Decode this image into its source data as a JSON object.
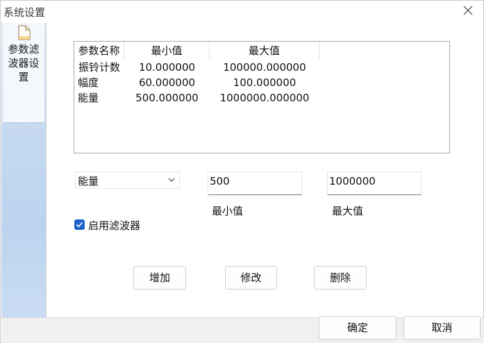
{
  "window": {
    "title": "系统设置",
    "close_icon": "close-icon"
  },
  "sidebar": {
    "items": [
      {
        "label": "参数滤波器设置",
        "icon": "document-icon"
      }
    ]
  },
  "table": {
    "columns": [
      "参数名称",
      "最小值",
      "最大值"
    ],
    "rows": [
      [
        "振铃计数",
        "10.000000",
        "100000.000000"
      ],
      [
        "幅度",
        "60.000000",
        "100.000000"
      ],
      [
        "能量",
        "500.000000",
        "1000000.000000"
      ]
    ]
  },
  "form": {
    "param_select": "能量",
    "min_value": "500",
    "max_value": "1000000",
    "min_label": "最小值",
    "max_label": "最大值",
    "enable_filter_label": "启用滤波器",
    "enable_filter_checked": true
  },
  "actions": {
    "add": "增加",
    "modify": "修改",
    "delete": "删除"
  },
  "footer": {
    "ok": "确定",
    "cancel": "取消"
  }
}
